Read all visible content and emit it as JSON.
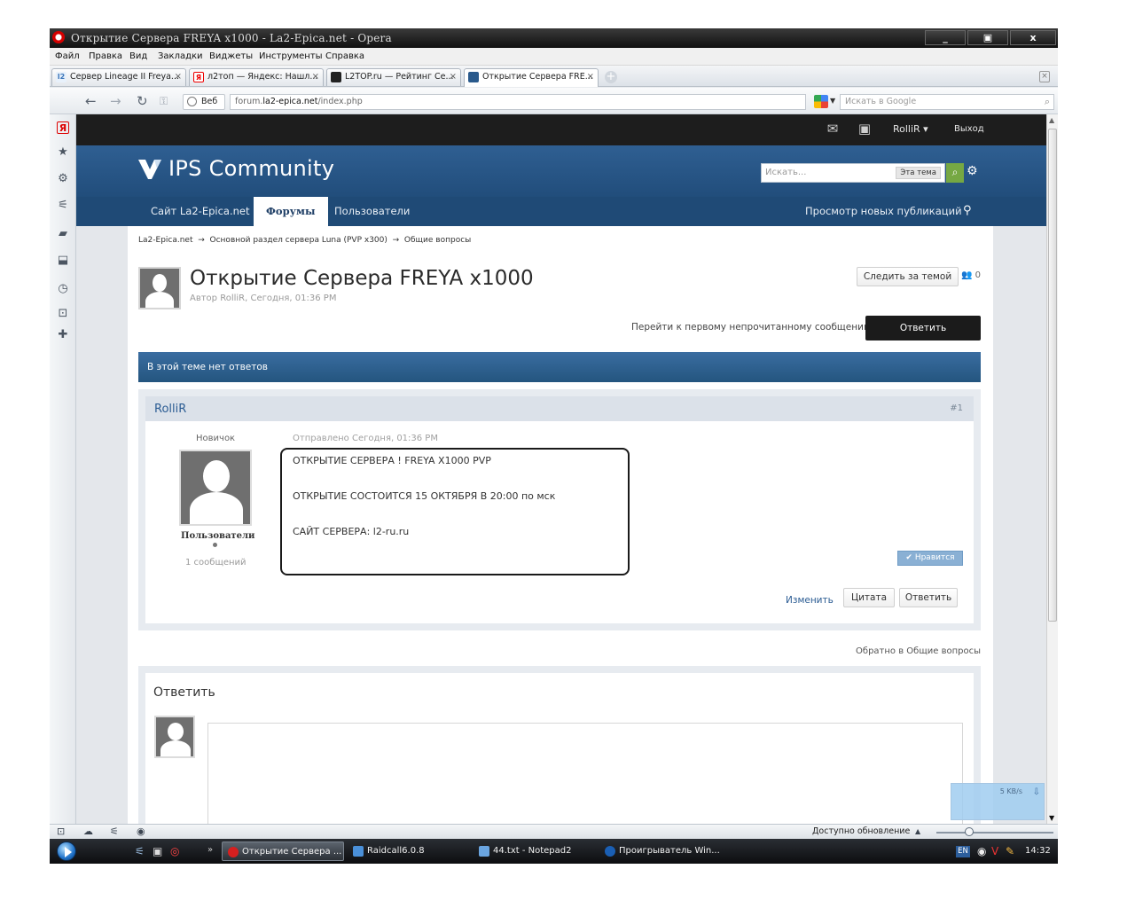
{
  "window": {
    "title": "Открытие Сервера FREYA x1000 - La2-Epica.net - Opera",
    "minimize": "_",
    "restore": "▣",
    "close": "x"
  },
  "menu": [
    "Файл",
    "Правка",
    "Вид",
    "Закладки",
    "Виджеты",
    "Инструменты",
    "Справка"
  ],
  "tabs": [
    {
      "label": "Сервер Lineage II Freya...",
      "favicon": "l2-favicon",
      "favicon_color": "#e8f1fb",
      "favicon_text": "l2"
    },
    {
      "label": "л2топ — Яндекс: Нашл...",
      "favicon": "yandex-favicon",
      "favicon_color": "#ffffff",
      "favicon_text": "Я"
    },
    {
      "label": "L2TOP.ru — Рейтинг Се...",
      "favicon": "l2top-favicon",
      "favicon_color": "#222222",
      "favicon_text": ""
    },
    {
      "label": "Открытие Сервера FRE...",
      "favicon": "forum-favicon",
      "favicon_color": "#2a5a8c",
      "favicon_text": "",
      "active": true
    }
  ],
  "address": {
    "web_label": "Веб",
    "url_prefix": "forum.",
    "url_domain": "la2-epica.net",
    "url_path": "/index.php",
    "search_placeholder": "Искать в Google"
  },
  "forum": {
    "user_menu": "RolliR ▾",
    "logout": "Выход",
    "brand": "IPS Community",
    "search_placeholder": "Искать...",
    "search_scope": "Эта тема",
    "nav": [
      "Сайт La2-Epica.net",
      "Форумы",
      "Пользователи"
    ],
    "nav_active": "Форумы",
    "new_posts": "Просмотр новых публикаций",
    "breadcrumb": [
      "La2-Epica.net",
      "Основной раздел сервера Luna (PVP x300)",
      "Общие вопросы"
    ],
    "breadcrumb_sep": "→",
    "topic_title": "Открытие Сервера FREYA x1000",
    "topic_meta": "Автор RolliR, Сегодня, 01:36 PM",
    "follow": "Следить за темой",
    "followers": "0",
    "first_unread": "Перейти к первому непрочитанному сообщению",
    "reply_button": "Ответить",
    "no_replies": "В этой теме нет ответов",
    "post": {
      "author": "RolliR",
      "number": "#1",
      "rank": "Новичок",
      "group": "Пользователи",
      "post_count": "1 сообщений",
      "posted": "Отправлено Сегодня, 01:36 PM",
      "lines": [
        "ОТКРЫТИЕ СЕРВЕРА ! FREYA X1000 PVP",
        "ОТКРЫТИЕ СОСТОИТСЯ 15 ОКТЯБРЯ В 20:00 по мск",
        "САЙТ СЕРВЕРА: l2-ru.ru"
      ],
      "like": "Нравится",
      "edit": "Изменить",
      "quote": "Цитата",
      "reply": "Ответить"
    },
    "back_link": "Обратно в Общие вопросы",
    "reply_section_title": "Ответить"
  },
  "net_widget": {
    "speed": "5 KB/s"
  },
  "status": {
    "update": "Доступно обновление"
  },
  "taskbar": {
    "tasks": [
      {
        "label": "Открытие Сервера ...",
        "color": "#d61f1f",
        "active": true
      },
      {
        "label": "Raidcall6.0.8",
        "color": "#4a90d9"
      },
      {
        "label": "44.txt - Notepad2",
        "color": "#6aa5e0"
      },
      {
        "label": "Проигрыватель Win...",
        "color": "#1a5fb4"
      }
    ],
    "lang": "EN",
    "clock": "14:32"
  }
}
